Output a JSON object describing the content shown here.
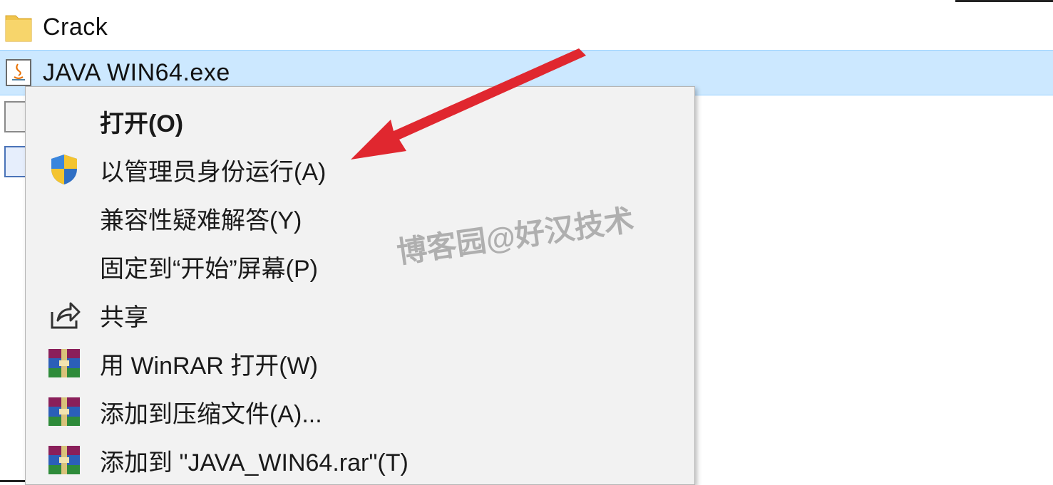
{
  "files": {
    "folder_name": "Crack",
    "selected_name": "JAVA WIN64.exe"
  },
  "context_menu": {
    "items": [
      {
        "label": "打开(O)",
        "icon": "none",
        "bold": true
      },
      {
        "label": "以管理员身份运行(A)",
        "icon": "uac-shield-icon"
      },
      {
        "label": "兼容性疑难解答(Y)",
        "icon": "none"
      },
      {
        "label": "固定到“开始”屏幕(P)",
        "icon": "none"
      },
      {
        "label": "共享",
        "icon": "share-icon"
      },
      {
        "label": "用 WinRAR 打开(W)",
        "icon": "winrar-icon"
      },
      {
        "label": "添加到压缩文件(A)...",
        "icon": "winrar-icon"
      },
      {
        "label": "添加到 \"JAVA_WIN64.rar\"(T)",
        "icon": "winrar-icon"
      }
    ]
  },
  "watermark": "博客园@好汉技术",
  "colors": {
    "selection": "#cce8ff",
    "menu_bg": "#f2f2f2",
    "arrow": "#e0272f"
  }
}
